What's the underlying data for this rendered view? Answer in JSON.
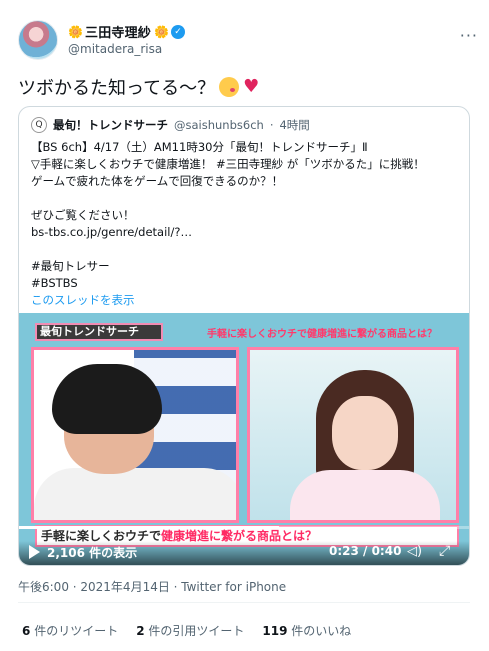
{
  "author": {
    "display_name": "三田寺理紗",
    "handle": "@mitadera_risa",
    "flower_left": "🌼",
    "flower_right": "🌼",
    "verified_mark": "✓",
    "more_label": "···"
  },
  "tweet": {
    "text": "ツボかるた知ってる～？",
    "emoji_icons": [
      "kissing-face-icon",
      "red-heart-icon"
    ],
    "heart_glyph": "♥"
  },
  "quoted": {
    "avatar_glyph": "Q",
    "name": "最旬！トレンドサーチ",
    "handle": "@saishunbs6ch",
    "dot": "·",
    "time": "4時間",
    "lines": [
      "【BS 6ch】4/17（土）AM11時30分「最旬！トレンドサーチ」Ⅱ",
      "▽手軽に楽しくおウチで健康増進！ #三田寺理紗 が「ツボかるた」に挑戦！",
      "ゲームで疲れた体をゲームで回復できるのか？！",
      "",
      "ぜひご覧ください！",
      "bs-tbs.co.jp/genre/detail/?…",
      "",
      "#最旬トレサー",
      "#BSTBS"
    ],
    "show_thread": "このスレッドを表示"
  },
  "video": {
    "banner": "最旬トレンドサーチ",
    "top_caption": "手軽に楽しくおウチで健康増進に繋がる商品とは？",
    "caption_pre": "手軽に楽しくおウチで",
    "caption_hl": "健康増進に繋がる商品とは？",
    "views": "2,106 件の表示",
    "time": "0:23 / 0:40",
    "progress": 0.575,
    "volume_glyph": "◁)",
    "fullscreen_glyph": "⤢"
  },
  "meta": {
    "timestamp": "午後6:00 · 2021年4月14日 · Twitter for iPhone"
  },
  "stats": {
    "retweets_count": "6",
    "retweets_label": "件のリツイート",
    "quotes_count": "2",
    "quotes_label": "件の引用ツイート",
    "likes_count": "119",
    "likes_label": "件のいいね"
  },
  "colors": {
    "accent": "#1d9bf0",
    "caption_pink": "#ff2a64",
    "frame_pink": "#ff7fa8"
  }
}
